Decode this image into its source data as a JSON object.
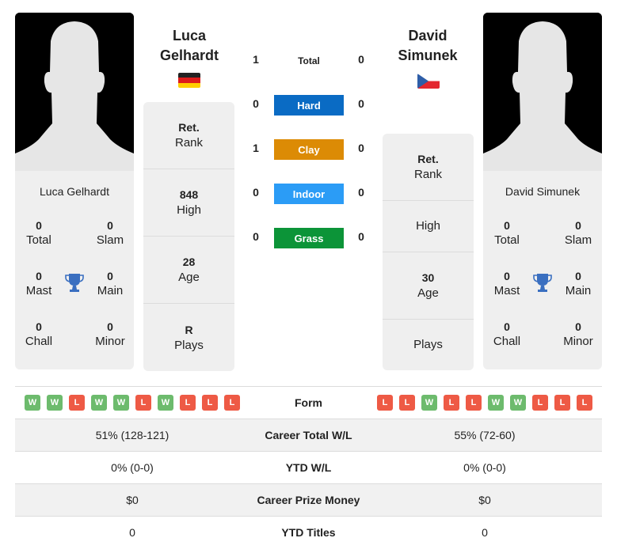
{
  "player1": {
    "name_line1": "Luca",
    "name_line2": "Gelhardt",
    "full_name": "Luca Gelhardt",
    "country_flag": "germany-flag",
    "titles": {
      "total": {
        "value": "0",
        "label": "Total"
      },
      "slam": {
        "value": "0",
        "label": "Slam"
      },
      "mast": {
        "value": "0",
        "label": "Mast"
      },
      "main": {
        "value": "0",
        "label": "Main"
      },
      "chall": {
        "value": "0",
        "label": "Chall"
      },
      "minor": {
        "value": "0",
        "label": "Minor"
      }
    },
    "info": [
      {
        "value": "Ret.",
        "label": "Rank"
      },
      {
        "value": "848",
        "label": "High"
      },
      {
        "value": "28",
        "label": "Age"
      },
      {
        "value": "R",
        "label": "Plays"
      }
    ],
    "form": [
      "W",
      "W",
      "L",
      "W",
      "W",
      "L",
      "W",
      "L",
      "L",
      "L"
    ],
    "career_wl": "51% (128-121)",
    "ytd_wl": "0% (0-0)",
    "prize_money": "$0",
    "ytd_titles": "0"
  },
  "player2": {
    "name_line1": "David",
    "name_line2": "Simunek",
    "full_name": "David Simunek",
    "country_flag": "czech-flag",
    "titles": {
      "total": {
        "value": "0",
        "label": "Total"
      },
      "slam": {
        "value": "0",
        "label": "Slam"
      },
      "mast": {
        "value": "0",
        "label": "Mast"
      },
      "main": {
        "value": "0",
        "label": "Main"
      },
      "chall": {
        "value": "0",
        "label": "Chall"
      },
      "minor": {
        "value": "0",
        "label": "Minor"
      }
    },
    "info": [
      {
        "value": "Ret.",
        "label": "Rank"
      },
      {
        "value": "",
        "label": "High"
      },
      {
        "value": "30",
        "label": "Age"
      },
      {
        "value": "",
        "label": "Plays"
      }
    ],
    "form": [
      "L",
      "L",
      "W",
      "L",
      "L",
      "W",
      "W",
      "L",
      "L",
      "L"
    ],
    "career_wl": "55% (72-60)",
    "ytd_wl": "0% (0-0)",
    "prize_money": "$0",
    "ytd_titles": "0"
  },
  "h2h": {
    "total": {
      "label": "Total",
      "p1": "1",
      "p2": "0"
    },
    "surfaces": [
      {
        "label": "Hard",
        "p1": "0",
        "p2": "0",
        "color": "#0a6bc4"
      },
      {
        "label": "Clay",
        "p1": "1",
        "p2": "0",
        "color": "#dc8b05"
      },
      {
        "label": "Indoor",
        "p1": "0",
        "p2": "0",
        "color": "#2b9cf6"
      },
      {
        "label": "Grass",
        "p1": "0",
        "p2": "0",
        "color": "#0c9438"
      }
    ]
  },
  "table": {
    "form_label": "Form",
    "career_wl_label": "Career Total W/L",
    "ytd_wl_label": "YTD W/L",
    "prize_label": "Career Prize Money",
    "ytd_titles_label": "YTD Titles"
  },
  "colors": {
    "win": "#6dbb6d",
    "loss": "#ee5a45",
    "trophy": "#3a6fc0"
  }
}
